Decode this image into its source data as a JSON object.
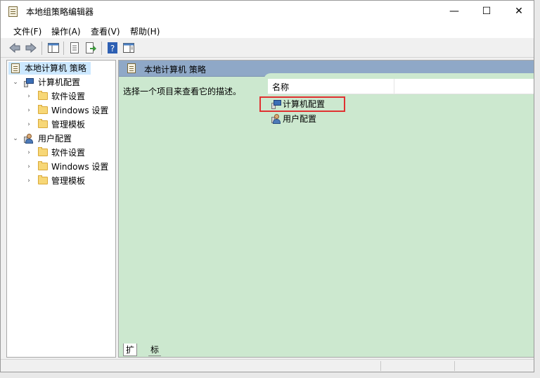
{
  "window": {
    "title": "本地组策略编辑器",
    "controls": {
      "minimize": "—",
      "maximize": "☐",
      "close": "✕"
    }
  },
  "menu": [
    "文件(F)",
    "操作(A)",
    "查看(V)",
    "帮助(H)"
  ],
  "toolbar": {
    "icons": [
      "back-icon",
      "forward-icon",
      "show-hide-tree-icon",
      "properties-icon",
      "export-list-icon",
      "help-icon",
      "show-hide-action-pane-icon"
    ]
  },
  "tree": {
    "root": "本地计算机 策略",
    "computer": {
      "label": "计算机配置",
      "children": [
        "软件设置",
        "Windows 设置",
        "管理模板"
      ]
    },
    "user": {
      "label": "用户配置",
      "children": [
        "软件设置",
        "Windows 设置",
        "管理模板"
      ]
    }
  },
  "details": {
    "header": "本地计算机 策略",
    "description": "选择一个项目来查看它的描述。",
    "column_name": "名称",
    "items": [
      "计算机配置",
      "用户配置"
    ]
  },
  "tabs": [
    "扩展",
    "标准"
  ],
  "colors": {
    "details_bg": "#cce8cf",
    "header_bg": "#8fa8c7",
    "highlight": "#e03131",
    "selection": "#cce8ff"
  }
}
